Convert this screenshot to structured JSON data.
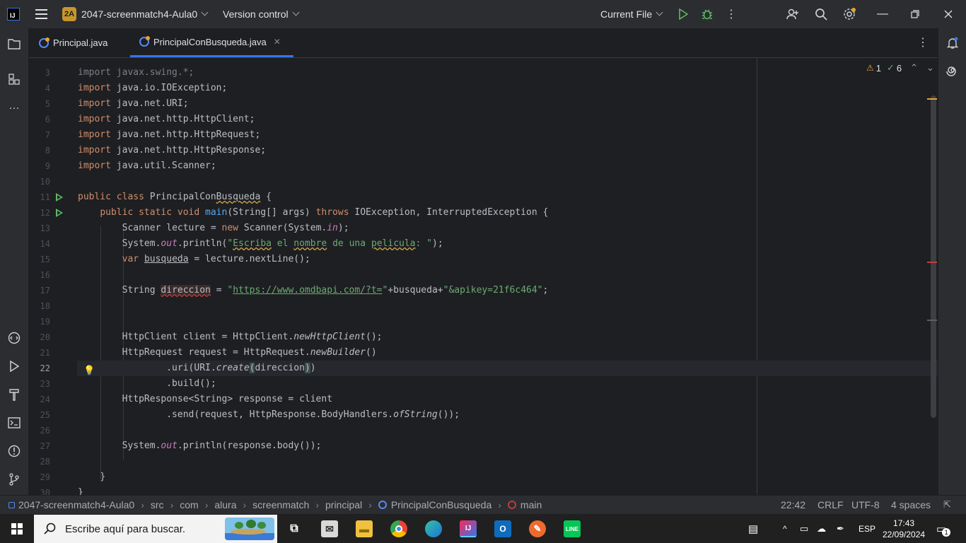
{
  "titlebar": {
    "project_badge": "2A",
    "project_name": "2047-screenmatch4-Aula0",
    "version_control": "Version control",
    "run_config": "Current File"
  },
  "tabs": [
    {
      "label": "Principal.java",
      "active": false
    },
    {
      "label": "PrincipalConBusqueda.java",
      "active": true
    }
  ],
  "inspections": {
    "warnings": "1",
    "checks": "6"
  },
  "editor": {
    "current_line": 22,
    "line_numbers": [
      "3",
      "4",
      "5",
      "6",
      "7",
      "8",
      "9",
      "10",
      "11",
      "12",
      "13",
      "14",
      "15",
      "16",
      "17",
      "18",
      "19",
      "20",
      "21",
      "22",
      "23",
      "24",
      "25",
      "26",
      "27",
      "28",
      "29",
      "30"
    ],
    "lines": {
      "l3": [
        "import",
        " javax.swing.*;"
      ],
      "l4": [
        "import",
        " java.io.IOException;"
      ],
      "l5": [
        "import",
        " java.net.URI;"
      ],
      "l6": [
        "import",
        " java.net.http.HttpClient;"
      ],
      "l7": [
        "import",
        " java.net.http.HttpRequest;"
      ],
      "l8": [
        "import",
        " java.net.http.HttpResponse;"
      ],
      "l9": [
        "import",
        " java.util.Scanner;"
      ],
      "l11": [
        "public class",
        " PrincipalCon",
        "Busqueda",
        " {"
      ],
      "l12": [
        "public static void",
        " ",
        "main",
        "(String[] args) ",
        "throws",
        " IOException, InterruptedException {"
      ],
      "l13": [
        "Scanner lecture = ",
        "new",
        " Scanner(System.",
        "in",
        ");"
      ],
      "l14": [
        "System.",
        "out",
        ".println(",
        "\"",
        "Escriba",
        " el ",
        "nombre",
        " de una ",
        "pelicula",
        ": \"",
        ");"
      ],
      "l15": [
        "var",
        " ",
        "busqueda",
        " = lecture.nextLine();"
      ],
      "l17": [
        "String ",
        "direccion",
        " = ",
        "\"",
        "https://www.omdbapi.com/?t=",
        "\"",
        "+busqueda+",
        "\"&apikey=21f6c464\"",
        ";"
      ],
      "l20": [
        "HttpClient client = HttpClient.",
        "newHttpClient",
        "();"
      ],
      "l21": [
        "HttpRequest request = HttpRequest.",
        "newBuilder",
        "()"
      ],
      "l22": [
        ".uri(URI.",
        "create",
        "(",
        "direccion",
        ")",
        ")"
      ],
      "l23": [
        ".build();"
      ],
      "l24": [
        "HttpResponse<String> response = client"
      ],
      "l25": [
        ".send(request, HttpResponse.BodyHandlers.",
        "ofString",
        "());"
      ],
      "l27": [
        "System.",
        "out",
        ".println(response.body());"
      ],
      "l29": [
        "}"
      ],
      "l30": [
        "}"
      ]
    }
  },
  "statusbar": {
    "breadcrumbs": [
      "2047-screenmatch4-Aula0",
      "src",
      "com",
      "alura",
      "screenmatch",
      "principal",
      "PrincipalConBusqueda",
      "main"
    ],
    "position": "22:42",
    "line_separator": "CRLF",
    "encoding": "UTF-8",
    "indent": "4 spaces"
  },
  "taskbar": {
    "search_placeholder": "Escribe aquí para buscar.",
    "language": "ESP",
    "time": "17:43",
    "date": "22/09/2024",
    "notifications": "1"
  },
  "colors": {
    "accent": "#3574f0",
    "keyword": "#cf8e6d",
    "string": "#6aab73",
    "function": "#56a8f5",
    "static_field": "#c77dbb"
  }
}
